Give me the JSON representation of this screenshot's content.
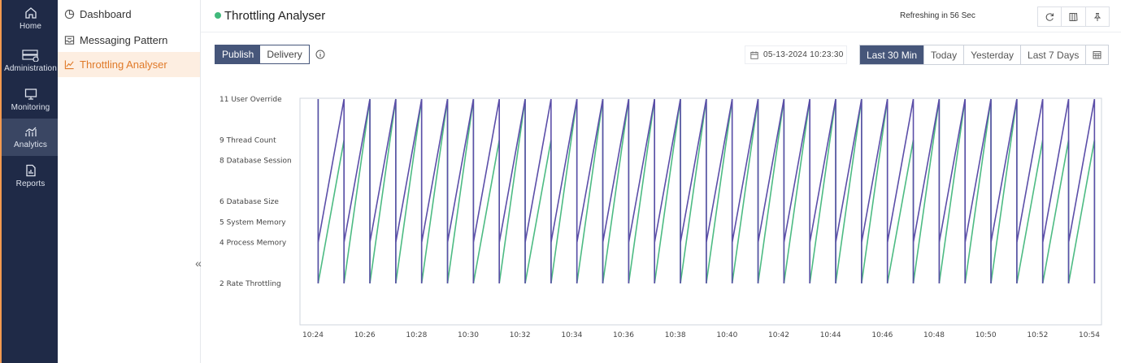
{
  "leftbar": {
    "items": [
      {
        "label": "Home",
        "icon": "home-icon"
      },
      {
        "label": "Administration",
        "icon": "server-icon"
      },
      {
        "label": "Monitoring",
        "icon": "monitor-icon"
      },
      {
        "label": "Analytics",
        "icon": "analytics-icon"
      },
      {
        "label": "Reports",
        "icon": "report-icon"
      }
    ],
    "active": "Analytics"
  },
  "subnav": {
    "items": [
      {
        "label": "Dashboard",
        "icon": "pie-icon"
      },
      {
        "label": "Messaging Pattern",
        "icon": "inbox-icon"
      },
      {
        "label": "Throttling Analyser",
        "icon": "line-chart-icon"
      }
    ],
    "active": "Throttling Analyser",
    "collapse_label": "«"
  },
  "header": {
    "title": "Throttling Analyser",
    "refresh_text": "Refreshing in 56 Sec",
    "status_color": "#41b97b"
  },
  "toolbar": {
    "mode_options": [
      "Publish",
      "Delivery"
    ],
    "mode_selected": "Publish",
    "date_value": "05-13-2024 10:23:30",
    "ranges": [
      "Last 30 Min",
      "Today",
      "Yesterday",
      "Last 7 Days"
    ],
    "range_selected": "Last 30 Min"
  },
  "colors": {
    "accent": "#f39a50",
    "navy": "#1f2a47",
    "selected": "#46567a",
    "series_purple": "#5b4ea8",
    "series_green": "#4dbb83"
  },
  "chart_data": {
    "type": "line",
    "y_categories": [
      {
        "value": 11,
        "label": "11 User Override"
      },
      {
        "value": 9,
        "label": "9 Thread Count"
      },
      {
        "value": 8,
        "label": "8 Database Session"
      },
      {
        "value": 6,
        "label": "6 Database Size"
      },
      {
        "value": 5,
        "label": "5 System Memory"
      },
      {
        "value": 4,
        "label": "4 Process Memory"
      },
      {
        "value": 2,
        "label": "2 Rate Throttling"
      }
    ],
    "ylim": [
      1,
      11
    ],
    "x_ticks": [
      "10:24",
      "10:26",
      "10:28",
      "10:30",
      "10:32",
      "10:34",
      "10:36",
      "10:38",
      "10:40",
      "10:42",
      "10:44",
      "10:46",
      "10:48",
      "10:50",
      "10:52",
      "10:54"
    ],
    "xlim_minutes": [
      23.5,
      54.5
    ],
    "series": [
      {
        "color": "#4dbb83",
        "x": [
          24.2,
          25.2,
          26.2,
          27.2,
          28.2,
          29.2,
          30.2,
          31.2,
          32.2,
          33.2,
          34.2,
          35.2,
          36.2,
          37.2,
          38.2,
          39.2,
          40.2,
          41.2,
          42.2,
          43.2,
          44.2,
          45.2,
          46.2,
          47.2,
          48.2,
          49.2,
          50.2,
          51.2,
          52.2,
          53.2,
          54.2
        ],
        "y": [
          9,
          9,
          11,
          11,
          11,
          11,
          11,
          9,
          11,
          9,
          11,
          11,
          11,
          11,
          11,
          11,
          11,
          11,
          11,
          11,
          11,
          11,
          11,
          9,
          11,
          11,
          11,
          11,
          9,
          9,
          9
        ]
      },
      {
        "color": "#5b4ea8",
        "x": [
          24.2,
          25.2,
          26.2,
          27.2,
          28.2,
          29.2,
          30.2,
          31.2,
          32.2,
          33.2,
          34.2,
          35.2,
          36.2,
          37.2,
          38.2,
          39.2,
          40.2,
          41.2,
          42.2,
          43.2,
          44.2,
          45.2,
          46.2,
          47.2,
          48.2,
          49.2,
          50.2,
          51.2,
          52.2,
          53.2,
          54.2
        ],
        "y": [
          11,
          11,
          11,
          11,
          11,
          11,
          11,
          11,
          11,
          11,
          11,
          11,
          11,
          11,
          11,
          11,
          11,
          11,
          11,
          11,
          11,
          11,
          11,
          11,
          11,
          11,
          11,
          11,
          11,
          11,
          11
        ]
      }
    ]
  }
}
